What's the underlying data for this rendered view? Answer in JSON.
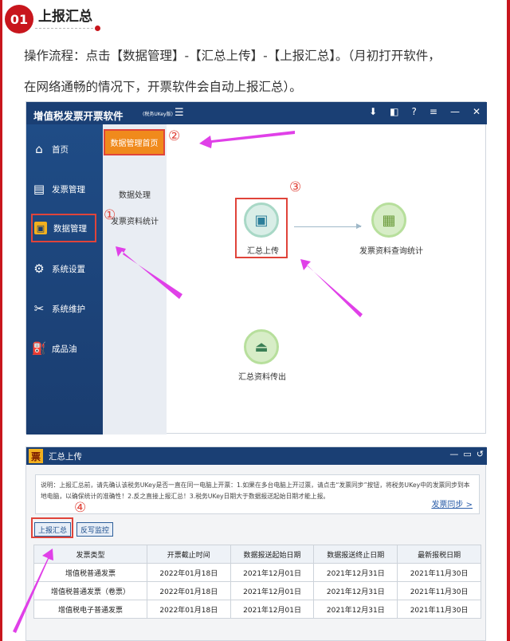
{
  "section": {
    "number": "01",
    "title": "上报汇总",
    "para1": "操作流程：点击【数据管理】-【汇总上传】-【上报汇总】。（月初打开软件，",
    "para2": "在网络通畅的情况下，开票软件会自动上报汇总）。"
  },
  "app1": {
    "title": "增值税发票开票软件",
    "subtitle": "(税务UKey版)",
    "sidebar": [
      "首页",
      "发票管理",
      "数据管理",
      "系统设置",
      "系统维护",
      "成品油"
    ],
    "submenu": [
      "数据管理首页",
      "数据处理",
      "发票资料统计"
    ],
    "nodes": [
      "汇总上传",
      "发票资料查询统计",
      "汇总资料传出"
    ],
    "markers": [
      "①",
      "②",
      "③"
    ]
  },
  "app2": {
    "logo": "票",
    "title": "汇总上传",
    "note": "说明：上报汇总前，请先确认该税务UKey是否一直在同一电脑上开票：1.如果在多台电脑上开过票，请点击“发票同步”按钮，将税务UKey中的发票同步到本地电脑，以确保统计的准确性！2.反之直接上报汇总！3.税务UKey日期大于数据报送起始日期才能上报。",
    "sync_link": "发票同步 >",
    "buttons": [
      "上报汇总",
      "反写监控"
    ],
    "marker": "④",
    "columns": [
      "发票类型",
      "开票截止时间",
      "数据报送起始日期",
      "数据报送终止日期",
      "最新报税日期"
    ],
    "rows": [
      [
        "增值税普通发票",
        "2022年01月18日",
        "2021年12月01日",
        "2021年12月31日",
        "2021年11月30日"
      ],
      [
        "增值税普通发票（卷票）",
        "2022年01月18日",
        "2021年12月01日",
        "2021年12月31日",
        "2021年11月30日"
      ],
      [
        "增值税电子普通发票",
        "2022年01月18日",
        "2021年12月01日",
        "2021年12月31日",
        "2021年11月30日"
      ]
    ]
  },
  "colors": {
    "frame": "#c8161d",
    "accent": "#e0443a",
    "arrow": "#e040e8",
    "orange": "#f08a1c",
    "navy": "#1a3f74"
  }
}
